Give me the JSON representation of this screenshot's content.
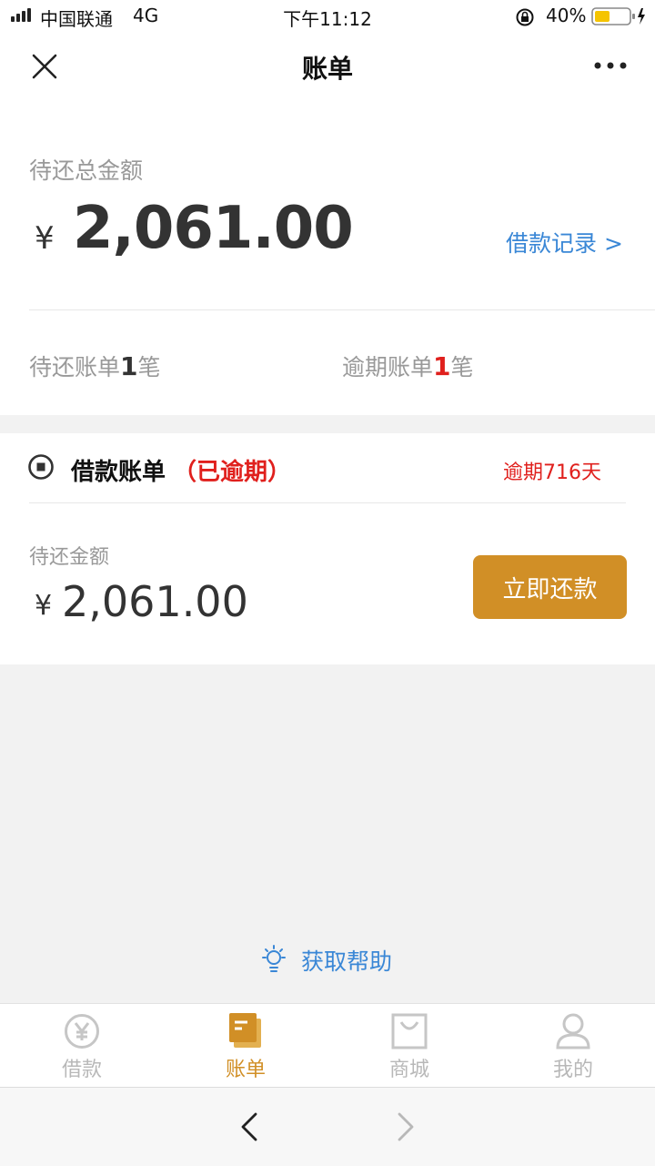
{
  "status_bar": {
    "carrier": "中国联通",
    "network": "4G",
    "time": "下午11:12",
    "battery": "40%"
  },
  "nav": {
    "title": "账单",
    "close_icon": "close-icon",
    "more_icon": "more-icon"
  },
  "summary": {
    "label": "待还总金额",
    "currency": "¥",
    "amount": "2,061.00",
    "record_link": "借款记录 >",
    "pending_prefix": "待还账单",
    "pending_count": "1",
    "pending_suffix": "笔",
    "overdue_prefix": "逾期账单",
    "overdue_count": "1",
    "overdue_suffix": "笔"
  },
  "bill": {
    "title": "借款账单",
    "status": "（已逾期）",
    "overdue_days": "逾期716天",
    "amount_label": "待还金额",
    "currency": "¥",
    "amount": "2,061.00",
    "repay_button": "立即还款"
  },
  "help": {
    "label": "获取帮助"
  },
  "tabs": [
    {
      "label": "借款",
      "icon": "yen-coin-icon",
      "active": false
    },
    {
      "label": "账单",
      "icon": "bill-icon",
      "active": true
    },
    {
      "label": "商城",
      "icon": "shopping-bag-icon",
      "active": false
    },
    {
      "label": "我的",
      "icon": "user-icon",
      "active": false
    }
  ],
  "colors": {
    "accent": "#d18f26",
    "link": "#3a87d6",
    "danger": "#e0201d",
    "muted": "#999999"
  }
}
